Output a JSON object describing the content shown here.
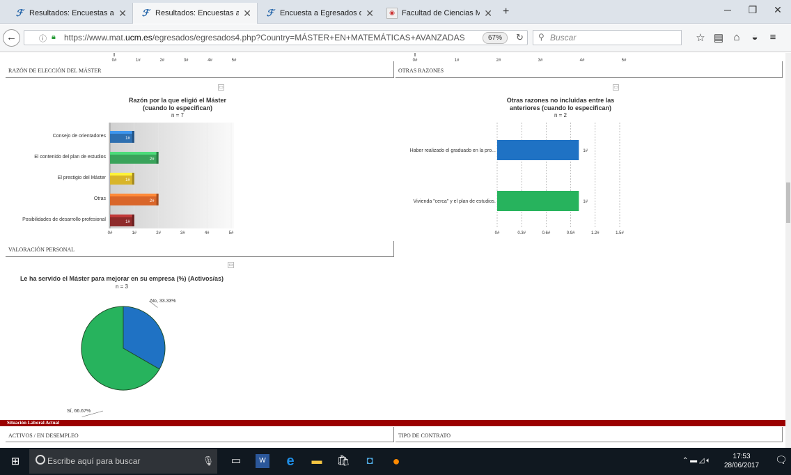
{
  "browser": {
    "tabs": [
      {
        "label": "Resultados: Encuestas a egre",
        "icon": "ucm-icon",
        "active": false
      },
      {
        "label": "Resultados: Encuestas a egre",
        "icon": "ucm-icon",
        "active": true
      },
      {
        "label": "Encuesta a Egresados de la F",
        "icon": "ucm-icon",
        "active": false
      },
      {
        "label": "Facultad de Ciencias Matem",
        "icon": "faculty-icon",
        "active": false
      }
    ],
    "new_tab": "+",
    "url_prefix": "https://www.mat.",
    "url_domain": "ucm.es",
    "url_path": "/egresados/egresados4.php?Country=MÁSTER+EN+MATEMÁTICAS+AVANZADAS",
    "zoom": "67%",
    "search_placeholder": "Buscar"
  },
  "sections": {
    "razon": "RAZÓN DE ELECCIÓN DEL MÁSTER",
    "otras": "OTRAS RAZONES",
    "valoracion": "VALORACIÓN PERSONAL",
    "situacion": "Situación Laboral Actual",
    "activos": "ACTIVOS / EN DESEMPLEO",
    "contrato": "TIPO DE CONTRATO"
  },
  "top_axis_ticks": [
    "0#",
    "1#",
    "2#",
    "3#",
    "4#",
    "5#"
  ],
  "chart1_title": "Razón por la que eligió el Máster",
  "chart1_title2": "(cuando lo especifican)",
  "chart1_n": "n = 7",
  "chart2_title": "Otras razones no incluidas entre las",
  "chart2_title2": "anteriores (cuando lo especifican)",
  "chart2_n": "n = 2",
  "chart3_title": "Le ha servido el Máster para mejorar en su empresa (%) (Activos/as)",
  "chart3_n": "n = 3",
  "chart_data": [
    {
      "type": "bar",
      "orientation": "horizontal",
      "title": "Razón por la que eligió el Máster (cuando lo especifican)",
      "subtitle": "n = 7",
      "categories": [
        "Consejo de orientadores",
        "El contenido del plan de estudios",
        "El prestigio del Máster",
        "Otras",
        "Posibilidades de desarrollo profesional"
      ],
      "values": [
        1,
        2,
        1,
        2,
        1
      ],
      "data_labels": [
        "1#",
        "2#",
        "1#",
        "2#",
        "1#"
      ],
      "colors": [
        "#2e6fb0",
        "#3aa35b",
        "#d8b52a",
        "#d9662a",
        "#8e2a2a"
      ],
      "xticks": [
        "0#",
        "1#",
        "2#",
        "3#",
        "4#",
        "5#"
      ],
      "xlim": [
        0,
        5
      ]
    },
    {
      "type": "bar",
      "orientation": "horizontal",
      "title": "Otras razones no incluidas entre las anteriores (cuando lo especifican)",
      "subtitle": "n = 2",
      "categories": [
        "Haber realizado el graduado en la pro...",
        "Vivienda \"cerca\" y el plan de estudios."
      ],
      "values": [
        1,
        1
      ],
      "data_labels": [
        "1#",
        "1#"
      ],
      "colors": [
        "#1f72c4",
        "#27b35d"
      ],
      "xticks": [
        "0#",
        "0.3#",
        "0.6#",
        "0.9#",
        "1.2#",
        "1.5#"
      ],
      "xlim": [
        0,
        1.5
      ]
    },
    {
      "type": "pie",
      "title": "Le ha servido el Máster para mejorar en su empresa (%) (Activos/as)",
      "subtitle": "n = 3",
      "categories": [
        "No",
        "Sí"
      ],
      "values": [
        33.33,
        66.67
      ],
      "labels": [
        "No, 33.33%",
        "Sí, 66.67%"
      ],
      "colors": [
        "#1f72c4",
        "#27b35d"
      ]
    }
  ],
  "taskbar": {
    "search_placeholder": "Escribe aquí para buscar",
    "time": "17:53",
    "date": "28/06/2017"
  }
}
